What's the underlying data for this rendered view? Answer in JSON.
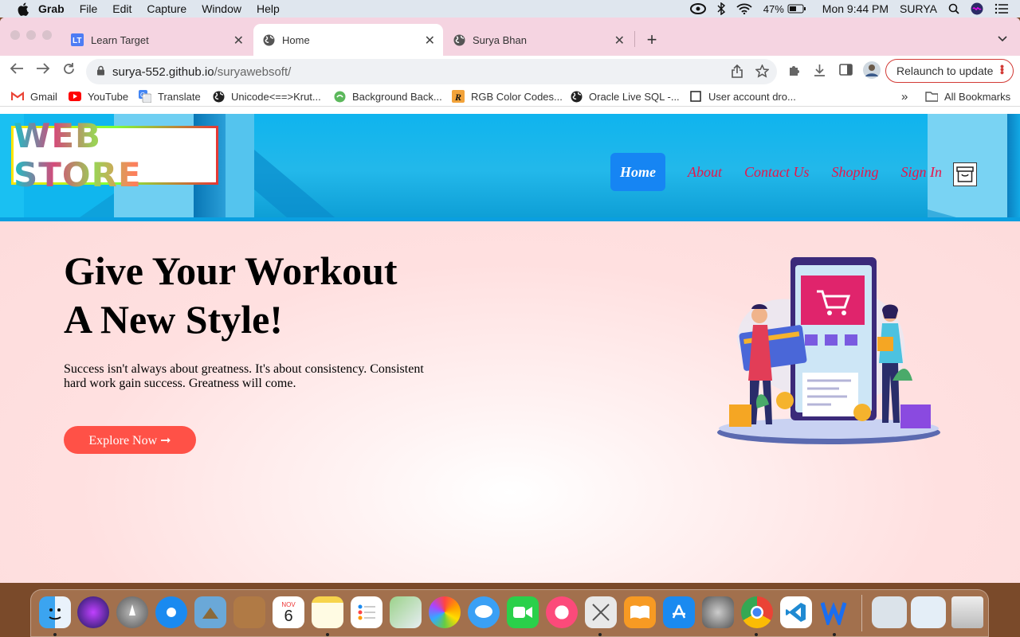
{
  "menubar": {
    "app": "Grab",
    "menus": [
      "File",
      "Edit",
      "Capture",
      "Window",
      "Help"
    ],
    "battery": "47%",
    "clock": "Mon 9:44 PM",
    "user": "SURYA"
  },
  "tabs": [
    {
      "title": "Learn Target",
      "icon": "lt-logo-icon",
      "active": false
    },
    {
      "title": "Home",
      "icon": "globe-icon",
      "active": true
    },
    {
      "title": "Surya Bhan",
      "icon": "globe-icon",
      "active": false
    }
  ],
  "address": {
    "domain": "surya-552.github.io",
    "path": "/suryawebsoft/"
  },
  "relaunch_label": "Relaunch to update",
  "bookmarks": [
    {
      "label": "Gmail",
      "icon": "gmail-icon"
    },
    {
      "label": "YouTube",
      "icon": "youtube-icon"
    },
    {
      "label": "Translate",
      "icon": "translate-icon"
    },
    {
      "label": "Unicode<==>Krut...",
      "icon": "globe-icon"
    },
    {
      "label": "Background Back...",
      "icon": "globe-icon"
    },
    {
      "label": "RGB Color Codes...",
      "icon": "rgb-logo-icon"
    },
    {
      "label": "Oracle Live SQL -...",
      "icon": "globe-icon"
    },
    {
      "label": "User account dro...",
      "icon": "page-icon"
    }
  ],
  "all_bookmarks_label": "All Bookmarks",
  "more_bookmarks_label": "»",
  "site": {
    "logo_text": "WEB STORE",
    "nav": [
      {
        "label": "Home",
        "active": true
      },
      {
        "label": "About",
        "active": false
      },
      {
        "label": "Contact Us",
        "active": false
      },
      {
        "label": "Shoping",
        "active": false
      },
      {
        "label": "Sign In",
        "active": false
      }
    ],
    "hero_title_line1": "Give Your Workout",
    "hero_title_line2": "A New Style!",
    "hero_text": "Success isn't always about greatness. It's about consistency. Consistent hard work gain success. Greatness will come.",
    "cta_label": "Explore Now ➞"
  },
  "colors": {
    "header_blue": "#10b6ee",
    "nav_active": "#1685f3",
    "nav_link": "#e8154a",
    "cta": "#ff5147",
    "tabstrip": "#f5d4e1"
  },
  "calendar": {
    "month": "NOV",
    "day": "6"
  },
  "dock_apps": [
    "Finder",
    "Siri",
    "Launchpad",
    "Safari",
    "Preview",
    "Notefile",
    "Calendar",
    "Notes",
    "Reminders",
    "Maps",
    "Photos",
    "Messages",
    "FaceTime",
    "Music",
    "Grab",
    "Books",
    "App Store",
    "System Preferences",
    "Chrome",
    "VS Code",
    "Word"
  ]
}
